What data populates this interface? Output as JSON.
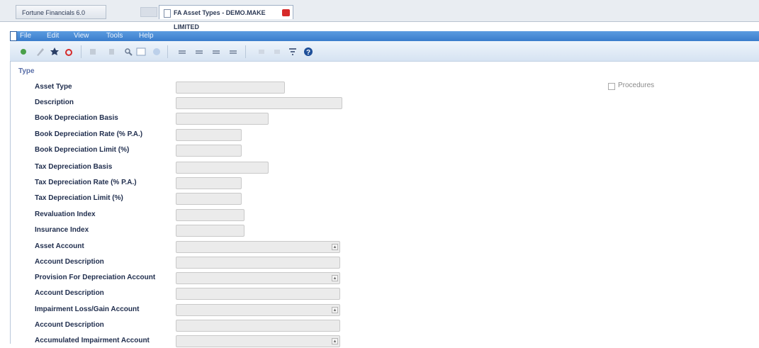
{
  "tabs": [
    {
      "label": "Fortune Financials 6.0"
    },
    {
      "label": "FA Asset Types - DEMO.MAKE LIMITED"
    }
  ],
  "menu": [
    "File",
    "Edit",
    "View",
    "Tools",
    "Help"
  ],
  "toolbar": {
    "items": [
      "new-icon",
      "edit-icon",
      "save-icon",
      "delete-icon",
      "undo-icon",
      "print-icon",
      "search-icon",
      "browse-icon",
      "info-icon",
      "first-icon",
      "prev-icon",
      "next-icon",
      "last-icon",
      "export-icon",
      "import-icon",
      "filter-icon",
      "help-icon"
    ]
  },
  "form": {
    "section_title": "Type",
    "fields": [
      {
        "label": "Asset Type",
        "value": ""
      },
      {
        "label": "Description",
        "value": ""
      },
      {
        "label": "Book Depreciation Basis",
        "value": ""
      },
      {
        "label": "Book Depreciation Rate (% P.A.)",
        "value": ""
      },
      {
        "label": "Book Depreciation Limit (%)",
        "value": ""
      },
      {
        "label": "Tax Depreciation Basis",
        "value": ""
      },
      {
        "label": "Tax Depreciation Rate (% P.A.)",
        "value": ""
      },
      {
        "label": "Tax Depreciation Limit (%)",
        "value": ""
      },
      {
        "label": "Revaluation Index",
        "value": ""
      },
      {
        "label": "Insurance Index",
        "value": ""
      },
      {
        "label": "Asset Account",
        "value": ""
      },
      {
        "label": "Account Description",
        "value": ""
      },
      {
        "label": "Provision For Depreciation Account",
        "value": ""
      },
      {
        "label": "Account Description",
        "value": ""
      },
      {
        "label": "Impairment Loss/Gain Account",
        "value": ""
      },
      {
        "label": "Account Description",
        "value": ""
      },
      {
        "label": "Accumulated Impairment Account",
        "value": ""
      }
    ],
    "checkbox_label": "Procedures"
  },
  "colors": {
    "menubar": "#3a7dcc",
    "field_bg": "#ebebeb",
    "section": "#5a6fa8"
  }
}
